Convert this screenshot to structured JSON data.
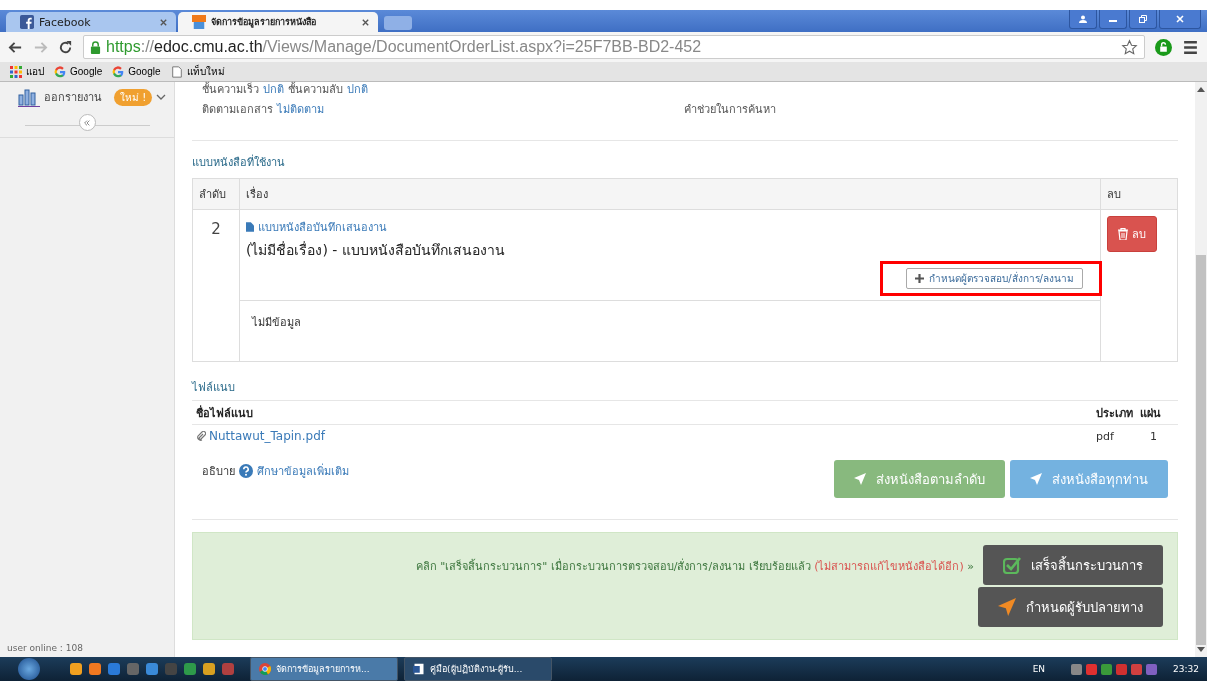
{
  "browser": {
    "tabs": [
      {
        "title": "Facebook",
        "selected": false
      },
      {
        "title": "จัดการข้อมูลรายการหนังสือ",
        "selected": true
      }
    ],
    "url": {
      "scheme": "https",
      "separator": "://",
      "host": "edoc.cmu.ac.th",
      "path": "/Views/Manage/DocumentOrderList.aspx?i=25F7BB-BD2-452"
    },
    "bookmarks": [
      {
        "label": "แอป",
        "kind": "apps"
      },
      {
        "label": "Google",
        "kind": "google"
      },
      {
        "label": "Google",
        "kind": "google"
      },
      {
        "label": "แท็บใหม่",
        "kind": "page"
      }
    ]
  },
  "sidebar": {
    "report_label": "ออกรายงาน",
    "badge": "ใหม่ !",
    "user_online": "user online : 108"
  },
  "details": {
    "speed_label": "ชั้นความเร็ว",
    "speed_value": "ปกติ",
    "secret_label": "ชั้นความลับ",
    "secret_value": "ปกติ",
    "track_label": "ติดตามเอกสาร",
    "track_value": "ไม่ติดตาม",
    "search_help": "คำช่วยในการค้นหา"
  },
  "templates": {
    "title": "แบบหนังสือที่ใช้งาน",
    "columns": [
      "ลำดับ",
      "เรื่อง",
      "ลบ"
    ],
    "rows": [
      {
        "order": "2",
        "link": "แบบหนังสือบันทึกเสนองาน",
        "title": "(ไม่มีชื่อเรื่อง) - แบบหนังสือบันทึกเสนองาน",
        "assign_button": "กำหนดผู้ตรวจสอบ/สั่งการ/ลงนาม",
        "highlighted": true,
        "note": "ไม่มีข้อมูล",
        "delete_button": "ลบ"
      }
    ]
  },
  "attachments": {
    "title": "ไฟล์แนบ",
    "columns": [
      "ชื่อไฟล์แนบ",
      "ประเภท",
      "แผ่น"
    ],
    "rows": [
      {
        "name": "Nuttawut_Tapin.pdf",
        "type": "pdf",
        "pages": "1"
      }
    ]
  },
  "help": {
    "label": "อธิบาย",
    "link": "ศึกษาข้อมูลเพิ่มเติม"
  },
  "send_buttons": [
    {
      "label": "ส่งหนังสือตามลำดับ",
      "kind": "sequential"
    },
    {
      "label": "ส่งหนังสือทุกท่าน",
      "kind": "all"
    }
  ],
  "finish": {
    "text": "คลิก \"เสร็จสิ้นกระบวนการ\" เมื่อกระบวนการตรวจสอบ/สั่งการ/ลงนาม เรียบร้อยแล้ว",
    "warning": "(ไม่สามารถแก้ไขหนังสือได้อีก)",
    "arrow": "»",
    "buttons": [
      {
        "label": "เสร็จสิ้นกระบวนการ",
        "kind": "finish"
      },
      {
        "label": "กำหนดผู้รับปลายทาง",
        "kind": "recipient"
      }
    ]
  },
  "taskbar": {
    "windows": [
      {
        "title": "จัดการข้อมูลรายการห...",
        "kind": "chrome",
        "selected": true
      },
      {
        "title": "คู่มือ(ผู้ปฏิบัติงาน-ผู้รับ...",
        "kind": "word",
        "selected": false
      }
    ],
    "language": "EN",
    "clock": "23:32"
  }
}
